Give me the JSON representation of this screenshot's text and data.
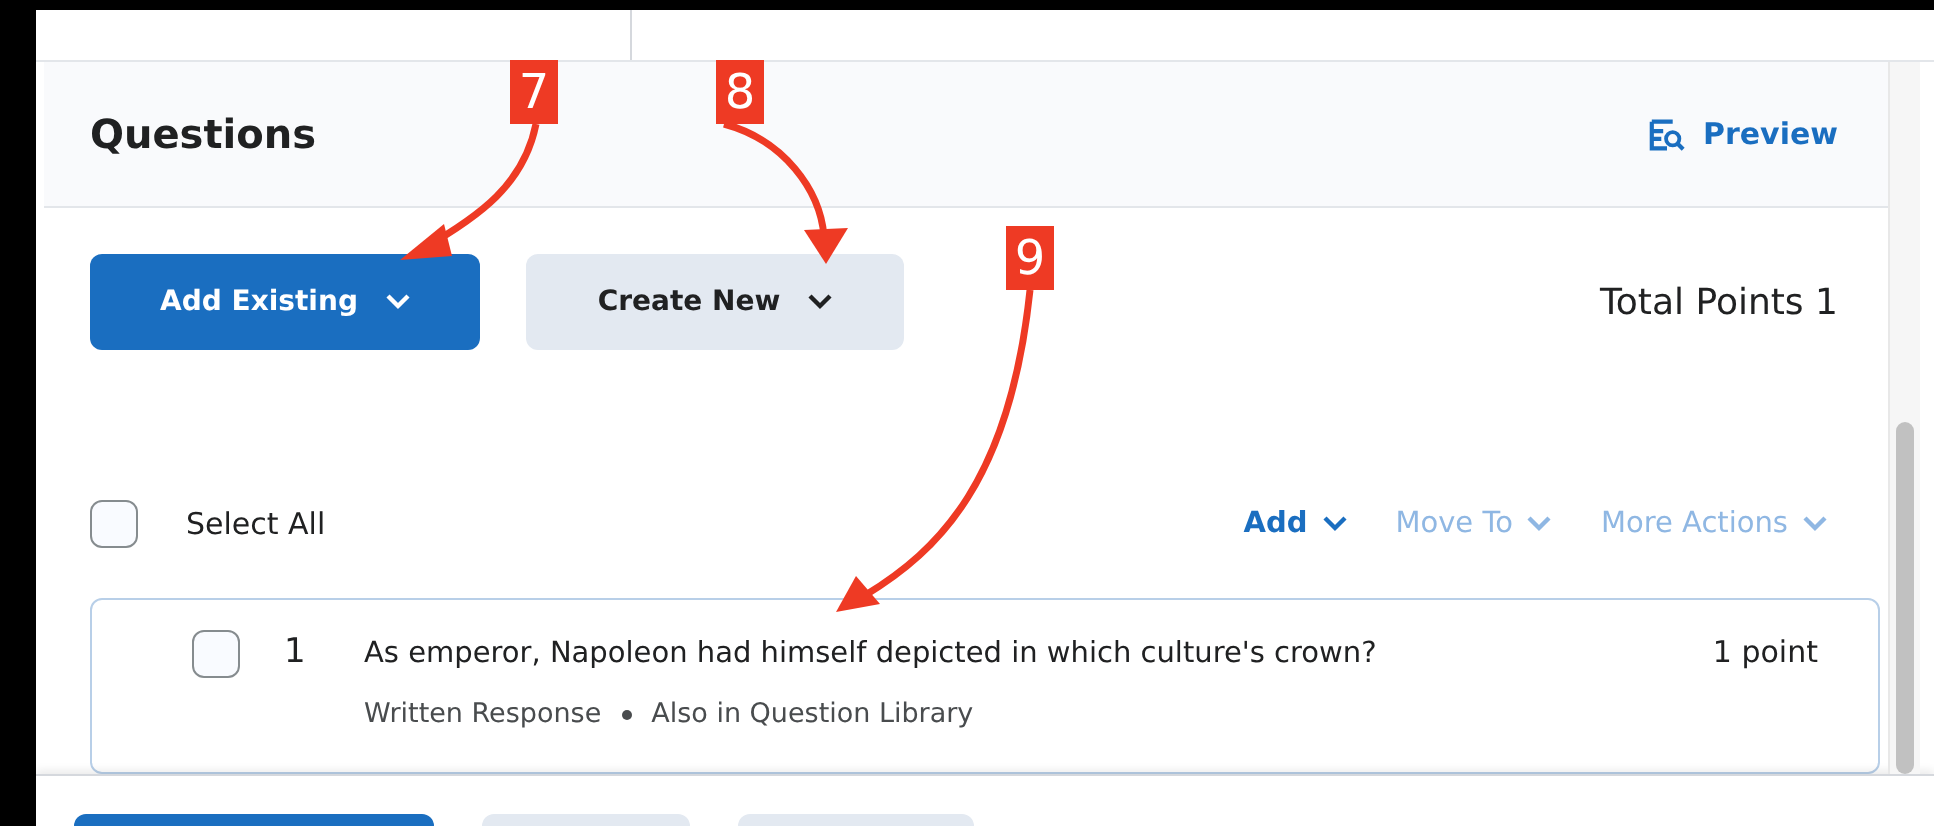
{
  "header": {
    "title": "Questions",
    "preview": "Preview"
  },
  "buttons": [
    {
      "label": "Add Existing",
      "kind": "primary"
    },
    {
      "label": "Create New",
      "kind": "secondary"
    }
  ],
  "total_points": "Total Points 1",
  "select_all": {
    "label": "Select All",
    "checked": false
  },
  "actions": [
    {
      "label": "Add",
      "disabled": false
    },
    {
      "label": "Move To",
      "disabled": true
    },
    {
      "label": "More Actions",
      "disabled": true
    }
  ],
  "questions": [
    {
      "number": "1",
      "text": "As emperor, Napoleon had himself depicted in which culture's crown?",
      "points": "1 point",
      "type": "Written Response",
      "library": "Also in Question Library",
      "checked": false
    }
  ],
  "callouts": [
    {
      "label": "7"
    },
    {
      "label": "8"
    },
    {
      "label": "9"
    }
  ],
  "footer_buttons": [
    {
      "kind": "primary"
    },
    {
      "kind": "secondary"
    },
    {
      "kind": "secondary"
    }
  ]
}
